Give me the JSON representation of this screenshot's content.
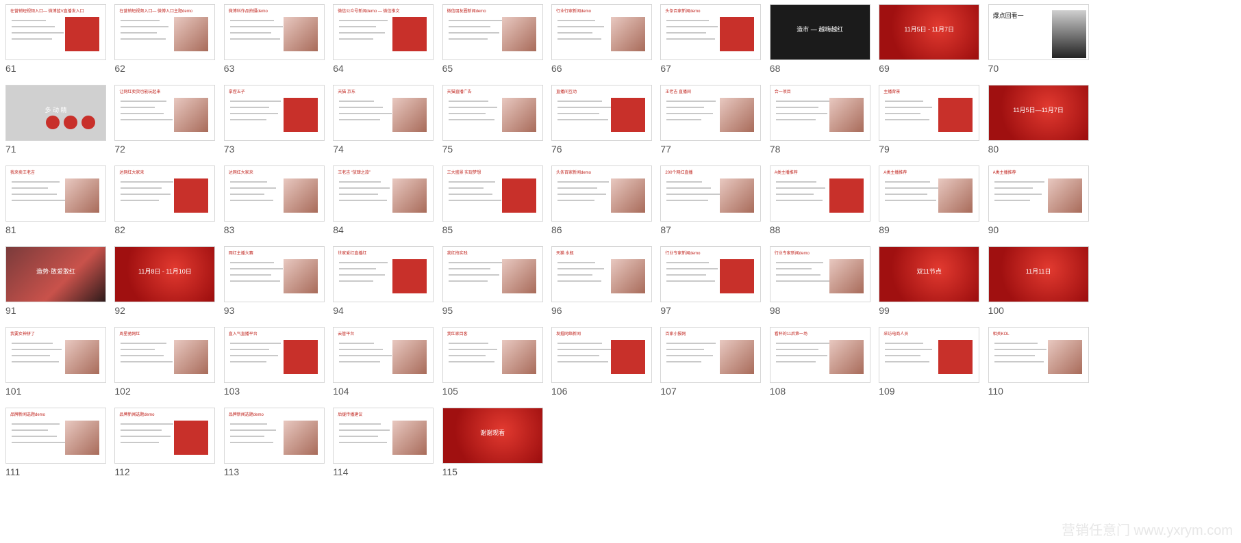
{
  "slides": [
    {
      "n": "61",
      "style": "light",
      "title": "在营销短视频入口— 微博蓝V直播发入口"
    },
    {
      "n": "62",
      "style": "light",
      "title": "在营销短视频入口— 微博入口主题demo"
    },
    {
      "n": "63",
      "style": "light",
      "title": "微博科作品拍摄demo"
    },
    {
      "n": "64",
      "style": "light",
      "title": "微信公众号新闻demo — 微信推文"
    },
    {
      "n": "65",
      "style": "light",
      "title": "微信朋友圈新闻demo"
    },
    {
      "n": "66",
      "style": "light",
      "title": "行业行家新闻demo"
    },
    {
      "n": "67",
      "style": "light",
      "title": "头条百家新闻demo"
    },
    {
      "n": "68",
      "style": "dark",
      "title": "造市 — 越嗨越红"
    },
    {
      "n": "69",
      "style": "red",
      "title": "11月5日 - 11月7日"
    },
    {
      "n": "70",
      "style": "jobs",
      "title": "爆点回看一"
    },
    {
      "n": "71",
      "style": "gray",
      "title": "多 动 精"
    },
    {
      "n": "72",
      "style": "light",
      "title": "让网红卖货也能玩起来"
    },
    {
      "n": "73",
      "style": "light",
      "title": "拿捏五子"
    },
    {
      "n": "74",
      "style": "light",
      "title": "天猫 京东"
    },
    {
      "n": "75",
      "style": "light",
      "title": "天猫直播广告"
    },
    {
      "n": "76",
      "style": "light",
      "title": "直播间互动"
    },
    {
      "n": "77",
      "style": "light",
      "title": "王老吉 直播间"
    },
    {
      "n": "78",
      "style": "light",
      "title": "合一项目"
    },
    {
      "n": "79",
      "style": "light",
      "title": "主播背景"
    },
    {
      "n": "80",
      "style": "red",
      "title": "11月5日—11月7日"
    },
    {
      "n": "81",
      "style": "light",
      "title": "我来卖王老吉"
    },
    {
      "n": "82",
      "style": "light",
      "title": "达网红大家来"
    },
    {
      "n": "83",
      "style": "light",
      "title": "达网红大家来"
    },
    {
      "n": "84",
      "style": "light",
      "title": "王老吉 “放肆之旅”"
    },
    {
      "n": "85",
      "style": "light",
      "title": "三大盛景 实现梦想"
    },
    {
      "n": "86",
      "style": "light",
      "title": "头条百家新闻demo"
    },
    {
      "n": "87",
      "style": "light",
      "title": "200个网红直播"
    },
    {
      "n": "88",
      "style": "light",
      "title": "A类主播推荐"
    },
    {
      "n": "89",
      "style": "light",
      "title": "A类主播推荐"
    },
    {
      "n": "90",
      "style": "light",
      "title": "A类主播推荐"
    },
    {
      "n": "91",
      "style": "photo",
      "title": "造势·敢爱敢红"
    },
    {
      "n": "92",
      "style": "red",
      "title": "11月8日 - 11月10日"
    },
    {
      "n": "93",
      "style": "light",
      "title": "网红主播大赛"
    },
    {
      "n": "94",
      "style": "light",
      "title": "世家爱红直播红"
    },
    {
      "n": "95",
      "style": "light",
      "title": "我红拍实践"
    },
    {
      "n": "96",
      "style": "light",
      "title": "天猫 水瓶"
    },
    {
      "n": "97",
      "style": "light",
      "title": "行业专家新闻demo"
    },
    {
      "n": "98",
      "style": "light",
      "title": "行业专家新闻demo"
    },
    {
      "n": "99",
      "style": "red",
      "title": "双11节点"
    },
    {
      "n": "100",
      "style": "red",
      "title": "11月11日"
    },
    {
      "n": "101",
      "style": "light",
      "title": "我要女神拼了"
    },
    {
      "n": "102",
      "style": "light",
      "title": "周星驰网红"
    },
    {
      "n": "103",
      "style": "light",
      "title": "直入气直播平台"
    },
    {
      "n": "104",
      "style": "light",
      "title": "云管平台"
    },
    {
      "n": "105",
      "style": "light",
      "title": "我红家目客"
    },
    {
      "n": "106",
      "style": "light",
      "title": "发掘网络新闻"
    },
    {
      "n": "107",
      "style": "light",
      "title": "百家小报网"
    },
    {
      "n": "108",
      "style": "light",
      "title": "看杯的11后第一场"
    },
    {
      "n": "109",
      "style": "light",
      "title": "采访电商人员"
    },
    {
      "n": "110",
      "style": "light",
      "title": "相关KOL"
    },
    {
      "n": "111",
      "style": "light",
      "title": "品牌新闻选题demo"
    },
    {
      "n": "112",
      "style": "light",
      "title": "品牌新闻选题demo"
    },
    {
      "n": "113",
      "style": "light",
      "title": "品牌新闻选题demo"
    },
    {
      "n": "114",
      "style": "light",
      "title": "后援传播建议"
    },
    {
      "n": "115",
      "style": "red",
      "title": "谢谢观看"
    }
  ],
  "watermark": "营销任意门 www.yxrym.com"
}
